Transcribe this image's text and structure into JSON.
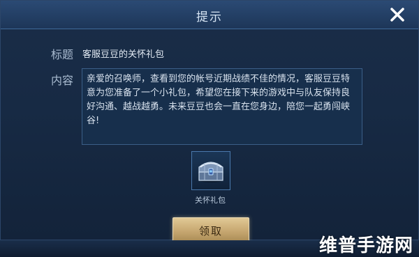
{
  "dialog": {
    "title": "提示",
    "close_icon": "close-x-icon"
  },
  "fields": {
    "title_label": "标题",
    "title_value": "客服豆豆的关怀礼包",
    "content_label": "内容",
    "content_text": "亲爱的召唤师，查看到您的帐号近期战绩不佳的情况，客服豆豆特意为您准备了一个小礼包，希望您在接下来的游戏中与队友保持良好沟通、越战越勇。未来豆豆也会一直在您身边，陪您一起勇闯峡谷!"
  },
  "gift": {
    "icon": "treasure-chest-icon",
    "label": "关怀礼包"
  },
  "actions": {
    "claim_label": "领取"
  },
  "watermark": {
    "text": "维普手游网"
  },
  "colors": {
    "accent_gold": "#c7a871",
    "header_blue": "#2b4a74",
    "panel_border": "#3b5f88"
  }
}
